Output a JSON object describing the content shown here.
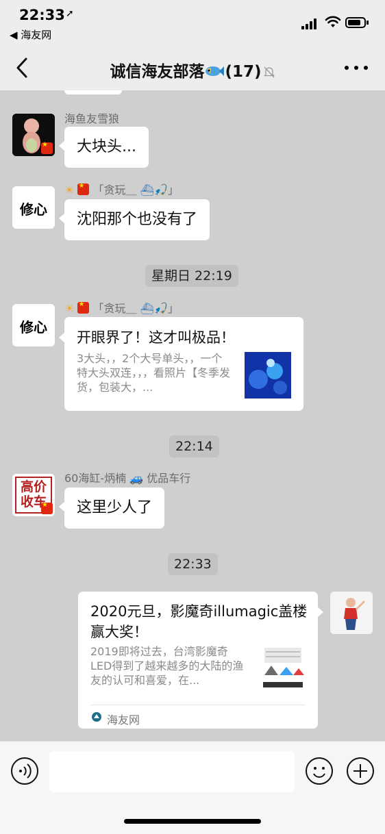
{
  "status_bar": {
    "time": "22:33",
    "back_app": "◀ 海友网"
  },
  "nav": {
    "title": "诚信海友部落",
    "member_count": "(17)"
  },
  "messages": [
    {
      "sender": "海鱼友雪狼",
      "text": "大块头..."
    },
    {
      "sender": "「贪玩＿",
      "text": "沈阳那个也没有了"
    },
    {
      "time": "星期日 22:19"
    },
    {
      "sender": "「贪玩＿",
      "card_title": "开眼界了！这才叫极品！",
      "card_desc": "3大头，，2个大号单头，，一个特大头双连，，，看照片【冬季发货，包装大，..."
    },
    {
      "time": "22:14"
    },
    {
      "sender": "60海缸-炳楠",
      "sender_suffix": "优品车行",
      "avatar_text": "高价收车",
      "text": "这里少人了"
    },
    {
      "time": "22:33"
    },
    {
      "card_title": "2020元旦，影魔奇illumagic盖楼赢大奖！",
      "card_desc": "2019即将过去，台湾影魔奇LED得到了越来越多的大陆的渔友的认可和喜爱，在...",
      "card_source": "海友网"
    }
  ],
  "avatar_logo_text": "修心",
  "colors": {
    "chat_bg": "#cfcfcf",
    "bar_bg": "#ededed",
    "bubble_bg": "#ffffff",
    "time_chip": "#c2c2c2"
  },
  "icons": [
    "location-arrow-icon",
    "signal-icon",
    "wifi-icon",
    "battery-icon",
    "back-chevron-icon",
    "fish-emoji-icon",
    "mute-bell-icon",
    "more-icon",
    "sun-emoji-icon",
    "china-flag-icon",
    "boat-emoji-icon",
    "fishing-emoji-icon",
    "car-emoji-icon",
    "source-logo-icon",
    "voice-icon",
    "emoji-icon",
    "plus-icon"
  ]
}
